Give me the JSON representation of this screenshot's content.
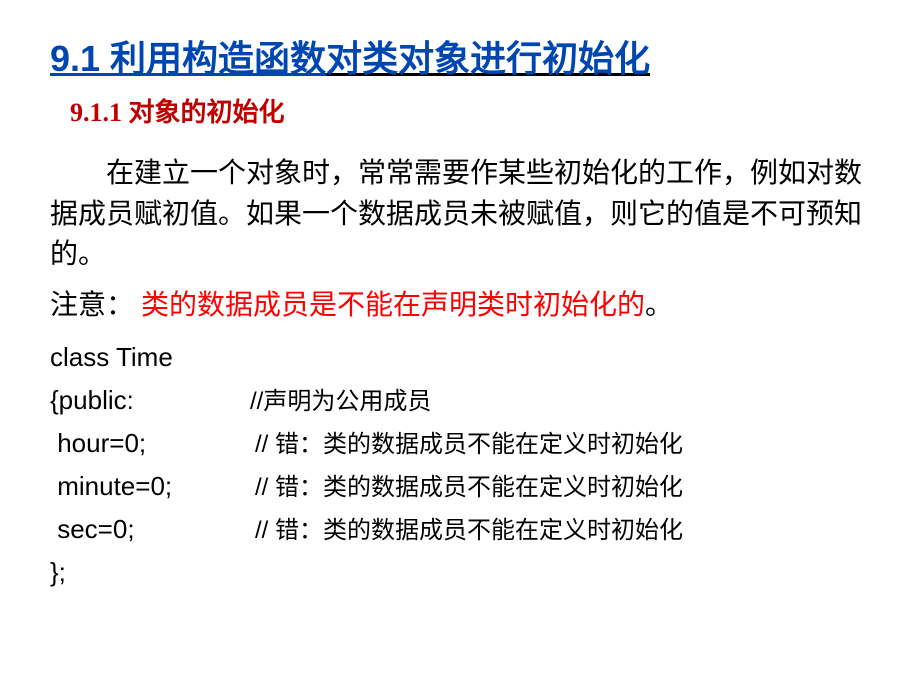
{
  "mainTitle": {
    "part1": "9.1  利用构造函数",
    "part2": "对类对象进行初始化"
  },
  "subTitle": "9.1.1 对象的初始化",
  "paragraph1": "在建立一个对象时，常常需要作某些初始化的工作，例如对数据成员赋初值。如果一个数据成员未被赋值，则它的值是不可预知的。",
  "note": {
    "label": "注意：  ",
    "content": "类的数据成员是不能在声明类时初始化的",
    "dot": "。"
  },
  "code": {
    "line1": {
      "text": "class Time"
    },
    "line2": {
      "text": "{public:",
      "comment": "//声明为公用成员"
    },
    "line3": {
      "text": " hour=0; ",
      "comment": "//  错：类的数据成员不能在定义时初始化"
    },
    "line4": {
      "text": " minute=0;",
      "comment": "//  错：类的数据成员不能在定义时初始化"
    },
    "line5": {
      "text": " sec=0;   ",
      "comment": "//  错：类的数据成员不能在定义时初始化"
    },
    "line6": {
      "text": "};"
    }
  }
}
